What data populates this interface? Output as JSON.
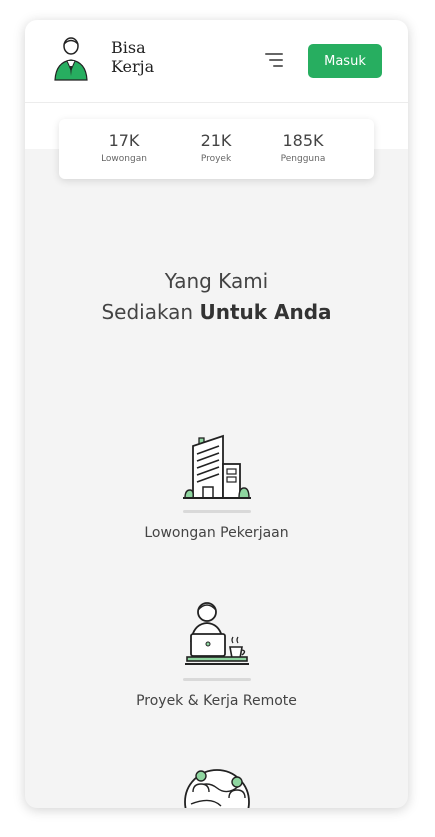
{
  "header": {
    "logo_line1": "Bisa",
    "logo_line2": "Kerja",
    "login_label": "Masuk"
  },
  "stats": [
    {
      "value": "17K",
      "label": "Lowongan"
    },
    {
      "value": "21K",
      "label": "Proyek"
    },
    {
      "value": "185K",
      "label": "Pengguna"
    }
  ],
  "section": {
    "title_line1": "Yang Kami",
    "title_line2_plain": "Sediakan ",
    "title_line2_bold": "Untuk Anda"
  },
  "services": [
    {
      "label": "Lowongan Pekerjaan",
      "icon": "office-building-icon"
    },
    {
      "label": "Proyek & Kerja Remote",
      "icon": "remote-worker-laptop-icon"
    },
    {
      "label": "",
      "icon": "globe-network-icon"
    }
  ],
  "colors": {
    "brand_green": "#27ae60",
    "icon_accent_green": "#8fd6a0",
    "background": "#f4f4f4"
  }
}
